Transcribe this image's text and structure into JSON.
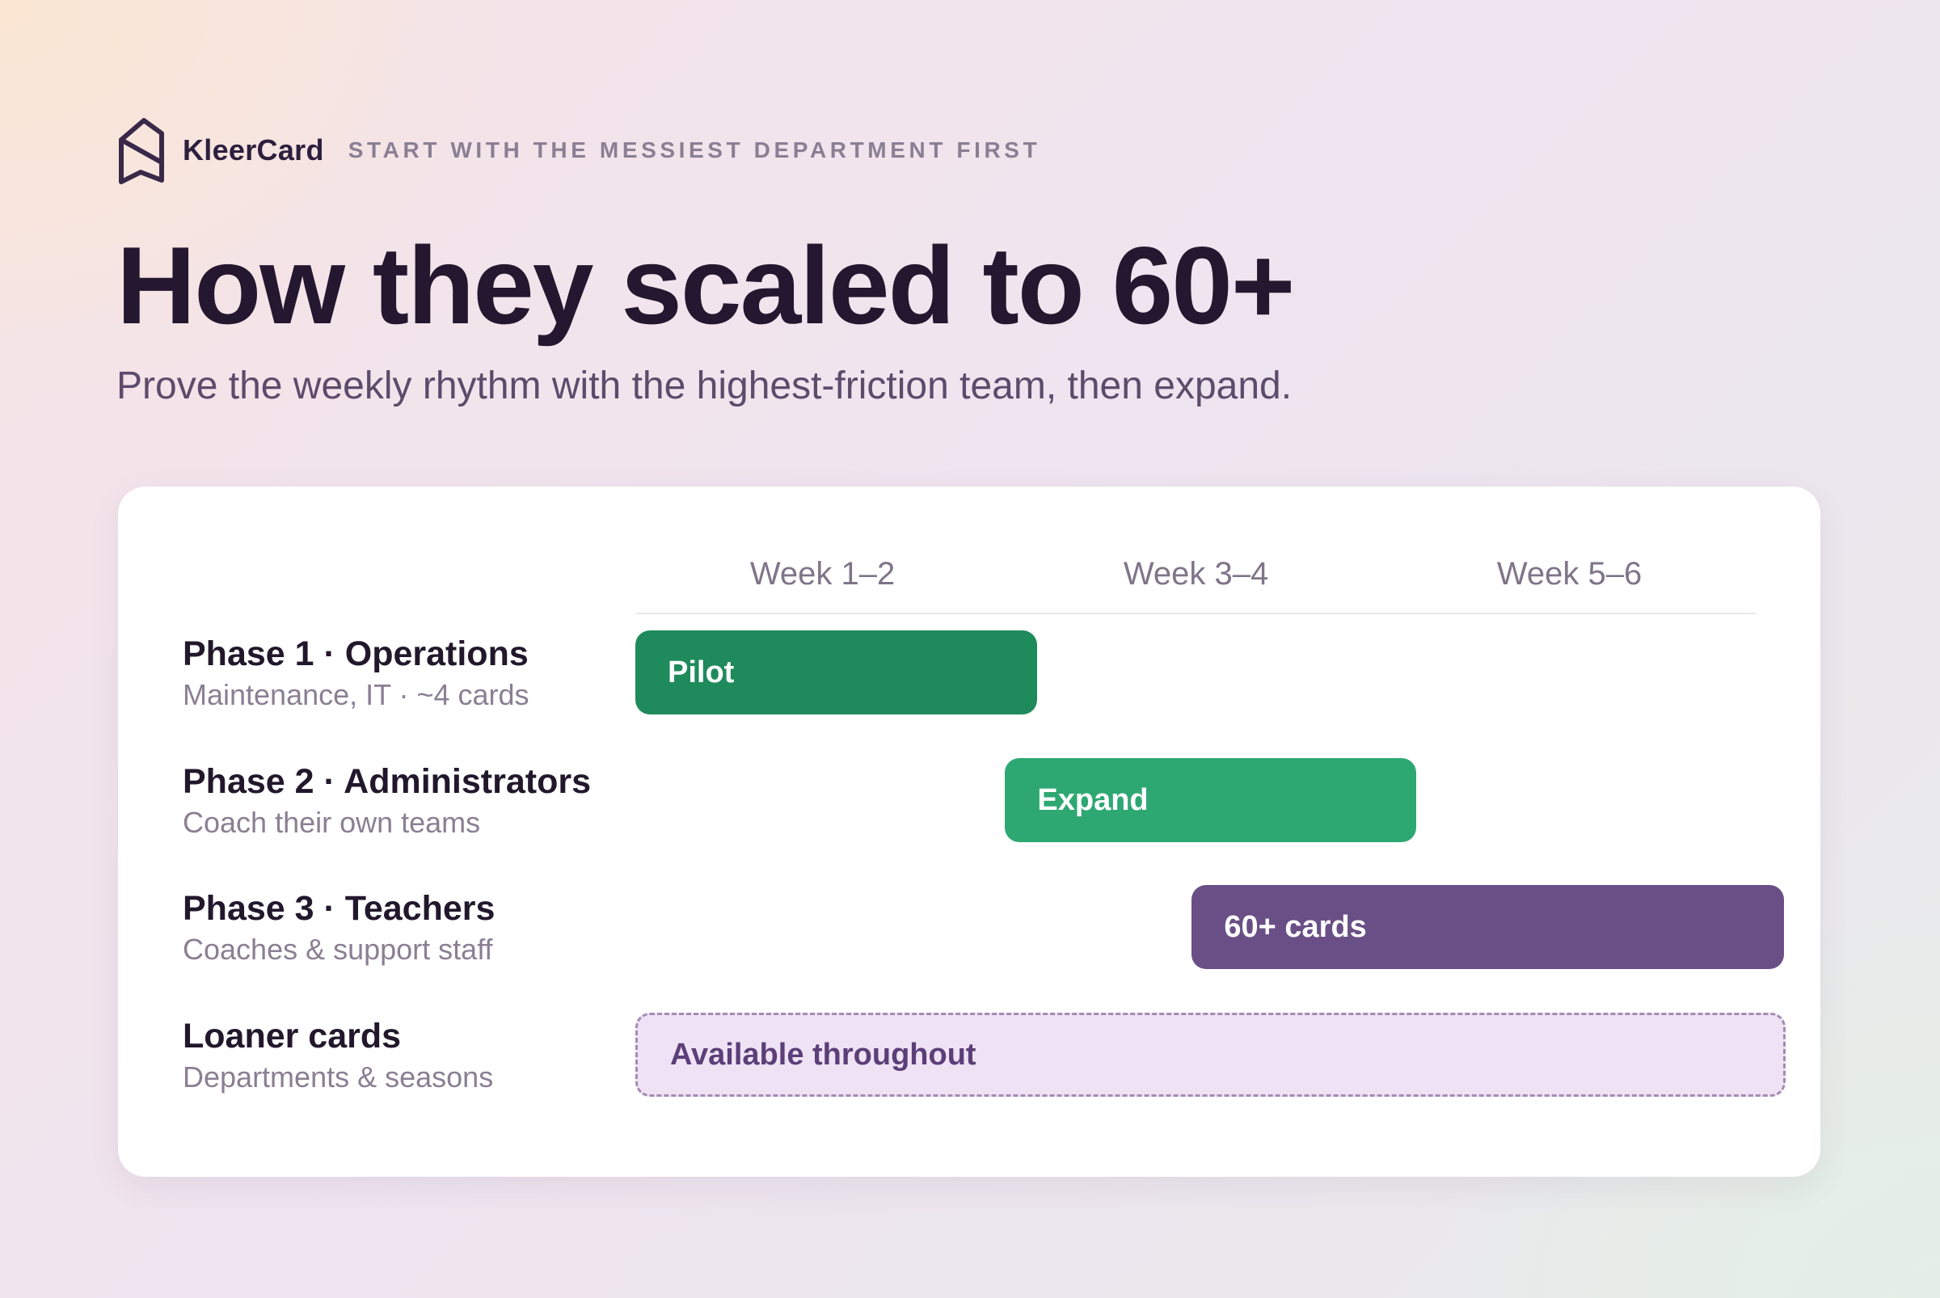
{
  "brand": {
    "name": "KleerCard",
    "eyebrow": "START WITH THE MESSIEST DEPARTMENT FIRST"
  },
  "headline": "How they scaled to 60+",
  "subhead": "Prove the weekly rhythm with the highest-friction team, then expand.",
  "colors": {
    "pilot": "#1f8a5b",
    "expand": "#2ea873",
    "scale": "#6a4f86",
    "loaner_fill": "#efe2f5",
    "loaner_text": "#5b3f78"
  },
  "chart_data": {
    "type": "gantt",
    "x_unit": "week",
    "xlim": [
      1,
      7
    ],
    "columns": [
      {
        "label": "Week 1–2",
        "start": 1,
        "end": 3
      },
      {
        "label": "Week 3–4",
        "start": 3,
        "end": 5
      },
      {
        "label": "Week 5–6",
        "start": 5,
        "end": 7
      }
    ],
    "rows": [
      {
        "title": "Phase 1 · Operations",
        "subtitle": "Maintenance, IT · ~4 cards",
        "bar": {
          "label": "Pilot",
          "start": 1,
          "end": 3.15,
          "fill": "#1f8a5b",
          "text": "#ffffff",
          "dashed": false
        }
      },
      {
        "title": "Phase 2 · Administrators",
        "subtitle": "Coach their own teams",
        "bar": {
          "label": "Expand",
          "start": 2.98,
          "end": 5.18,
          "fill": "#2ea873",
          "text": "#ffffff",
          "dashed": false
        }
      },
      {
        "title": "Phase 3 · Teachers",
        "subtitle": "Coaches & support staff",
        "bar": {
          "label": "60+ cards",
          "start": 3.98,
          "end": 7.15,
          "fill": "#6a4f86",
          "text": "#ffffff",
          "dashed": false
        }
      },
      {
        "title": "Loaner cards",
        "subtitle": "Departments & seasons",
        "bar": {
          "label": "Available throughout",
          "start": 1,
          "end": 7.16,
          "fill": "#efe2f5",
          "text": "#5b3f78",
          "dashed": true
        }
      }
    ]
  }
}
